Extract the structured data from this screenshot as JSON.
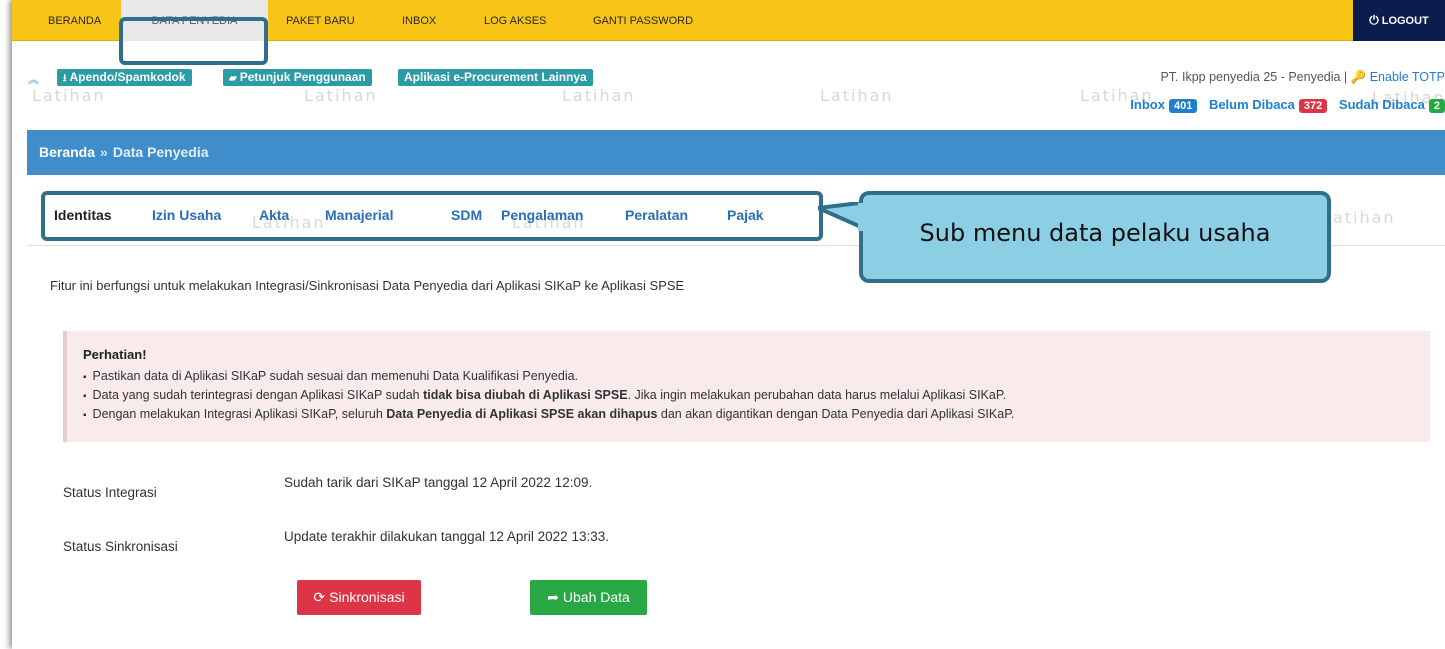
{
  "nav": {
    "items": [
      "BERANDA",
      "DATA PENYEDIA",
      "PAKET BARU",
      "INBOX",
      "LOG AKSES",
      "GANTI PASSWORD"
    ],
    "active": "DATA PENYEDIA",
    "logout_label": "LOGOUT"
  },
  "toolbar": {
    "links": [
      "Apendo/Spamkodok",
      "Petunjuk Penggunaan",
      "Aplikasi e-Procurement Lainnya"
    ],
    "user_text": "PT. Ikpp penyedia 25 - Penyedia | ",
    "totp_label": "Enable TOTP"
  },
  "watermark_text": "Latihan",
  "inbox": {
    "inbox_label": "Inbox",
    "inbox_count": "401",
    "unread_label": "Belum Dibaca",
    "unread_count": "372",
    "read_label": "Sudah Dibaca",
    "read_count": "2"
  },
  "breadcrumb": {
    "home": "Beranda",
    "separator": "»",
    "current": "Data Penyedia"
  },
  "tabs": [
    "Identitas",
    "Izin Usaha",
    "Akta",
    "Manajerial",
    "SDM",
    "Pengalaman",
    "Peralatan",
    "Pajak"
  ],
  "active_tab": "Identitas",
  "callout": "Sub menu data pelaku usaha",
  "intro": "Fitur ini berfungsi untuk melakukan Integrasi/Sinkronisasi Data Penyedia dari Aplikasi SIKaP ke Aplikasi SPSE",
  "alert": {
    "title": "Perhatian!",
    "item1": "Pastikan data di Aplikasi SIKaP sudah sesuai dan memenuhi Data Kualifikasi Penyedia.",
    "item2_a": "Data yang sudah terintegrasi dengan Aplikasi SIKaP sudah ",
    "item2_b": "tidak bisa diubah di Aplikasi SPSE",
    "item2_c": ". Jika ingin melakukan perubahan data harus melalui Aplikasi SIKaP.",
    "item3_a": "Dengan melakukan Integrasi Aplikasi SIKaP, seluruh ",
    "item3_b": "Data Penyedia di Aplikasi SPSE akan dihapus",
    "item3_c": " dan akan digantikan dengan Data Penyedia dari Aplikasi SIKaP."
  },
  "status": {
    "integrasi_label": "Status Integrasi",
    "integrasi_value": "Sudah tarik dari SIKaP tanggal 12 April 2022 12:09.",
    "sinkronisasi_label": "Status Sinkronisasi",
    "sinkronisasi_value": "Update terakhir dilakukan tanggal 12 April 2022 13:33."
  },
  "buttons": {
    "sync": "Sinkronisasi",
    "edit": "Ubah Data"
  },
  "colors": {
    "nav_bg": "#f7c417",
    "logout_bg": "#0b1d4e",
    "breadcrumb_bg": "#3f8ecb",
    "callout_bg": "#8ccfe5",
    "highlight_border": "#2f6f8c",
    "alert_bg": "#f9ebeb",
    "danger": "#dc3545",
    "success": "#28a745"
  }
}
